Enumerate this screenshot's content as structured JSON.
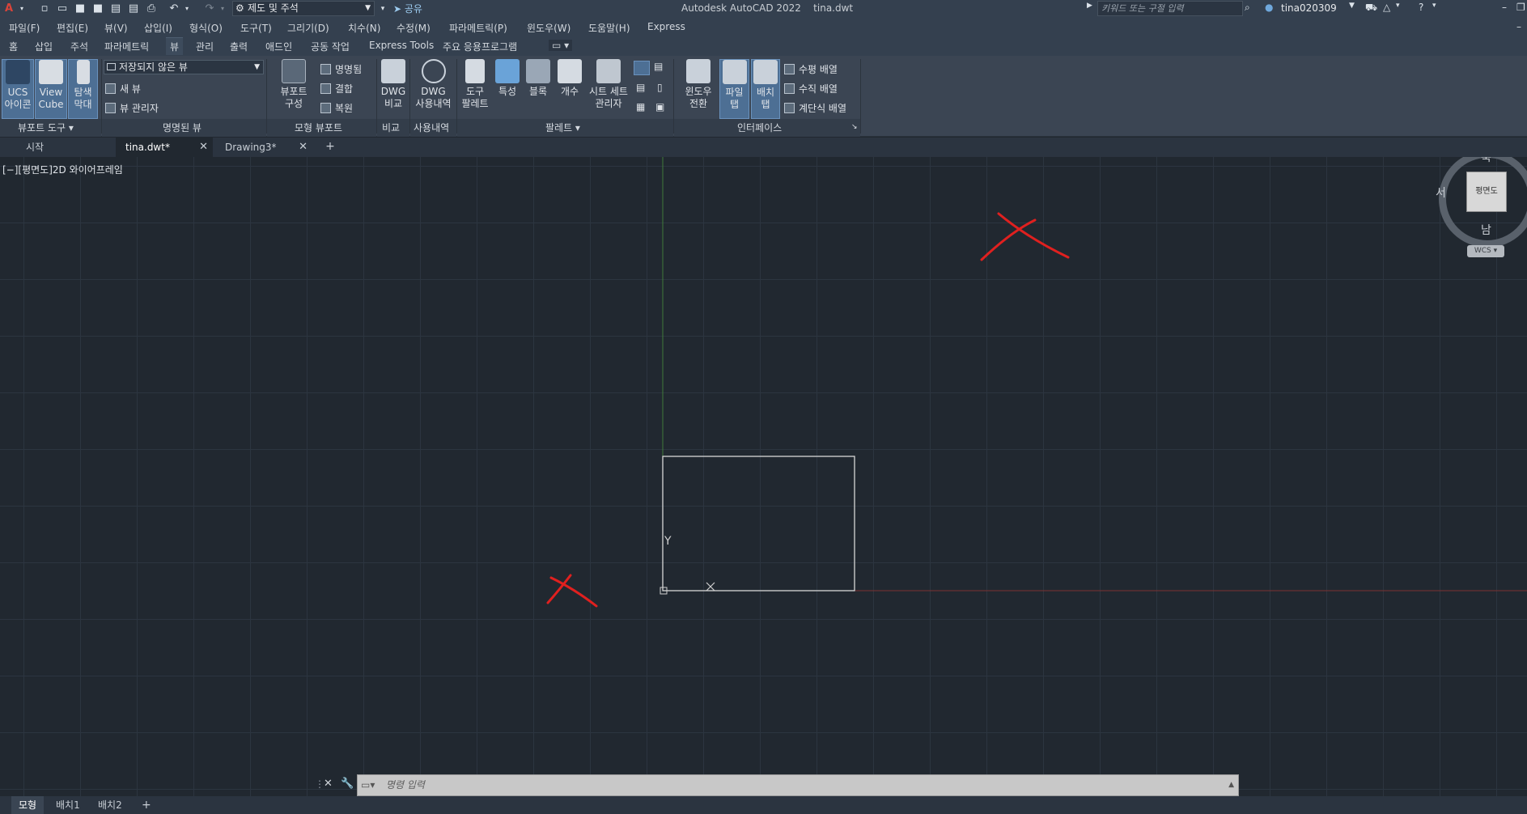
{
  "titlebar": {
    "workspace": "제도 및 주석",
    "share": "공유",
    "app_title": "Autodesk AutoCAD 2022    tina.dwt",
    "search_placeholder": "키워드 또는 구절 입력",
    "user": "tina020309"
  },
  "menu": [
    "파일(F)",
    "편집(E)",
    "뷰(V)",
    "삽입(I)",
    "형식(O)",
    "도구(T)",
    "그리기(D)",
    "치수(N)",
    "수정(M)",
    "파라메트릭(P)",
    "윈도우(W)",
    "도움말(H)",
    "Express"
  ],
  "ribbon_tabs": [
    "홈",
    "삽입",
    "주석",
    "파라메트릭",
    "뷰",
    "관리",
    "출력",
    "애드인",
    "공동 작업",
    "Express Tools",
    "주요 응용프로그램"
  ],
  "ribbon_active_tab": "뷰",
  "ribbon": {
    "viewport_tools": {
      "ucs_icon": "UCS\n아이콘",
      "view_cube": "View\nCube",
      "nav_bar": "탐색\n막대",
      "panel_label": "뷰포트 도구 ▾"
    },
    "named_views": {
      "dropdown": "저장되지 않은 뷰",
      "new_view": "새 뷰",
      "view_manager": "뷰 관리자",
      "panel_label": "명명된 뷰"
    },
    "model_viewports": {
      "viewport_config": "뷰포트\n구성",
      "named": "명명됨",
      "join": "결합",
      "restore": "복원",
      "panel_label": "모형 뷰포트"
    },
    "compare": {
      "dwg_compare": "DWG\n비교",
      "panel_label": "비교"
    },
    "history": {
      "dwg_history": "DWG\n사용내역",
      "panel_label": "사용내역"
    },
    "palettes": {
      "tool_palette": "도구\n팔레트",
      "properties": "특성",
      "block": "블록",
      "count": "개수",
      "sheet_set": "시트 세트\n관리자",
      "panel_label": "팔레트 ▾"
    },
    "interface": {
      "switch_windows": "윈도우\n전환",
      "file_tab": "파일\n탭",
      "layout_tab": "배치\n탭",
      "tile_horizontal": "수평 배열",
      "tile_vertical": "수직 배열",
      "cascade": "계단식 배열",
      "panel_label": "인터페이스"
    }
  },
  "file_tabs": [
    {
      "label": "시작"
    },
    {
      "label": "tina.dwt*"
    },
    {
      "label": "Drawing3*"
    }
  ],
  "viewport_label": "[−][평면도]2D 와이어프레임",
  "viewcube": {
    "north": "북",
    "south": "남",
    "west": "서",
    "face": "평면도",
    "wcs": "WCS"
  },
  "ucs": {
    "y": "Y"
  },
  "command_placeholder": "명령 입력",
  "layout_tabs": [
    "모형",
    "배치1",
    "배치2"
  ],
  "colors": {
    "annotation_red": "#e0201f",
    "y_axis": "#3f7a3a",
    "x_axis": "#7a3232"
  }
}
